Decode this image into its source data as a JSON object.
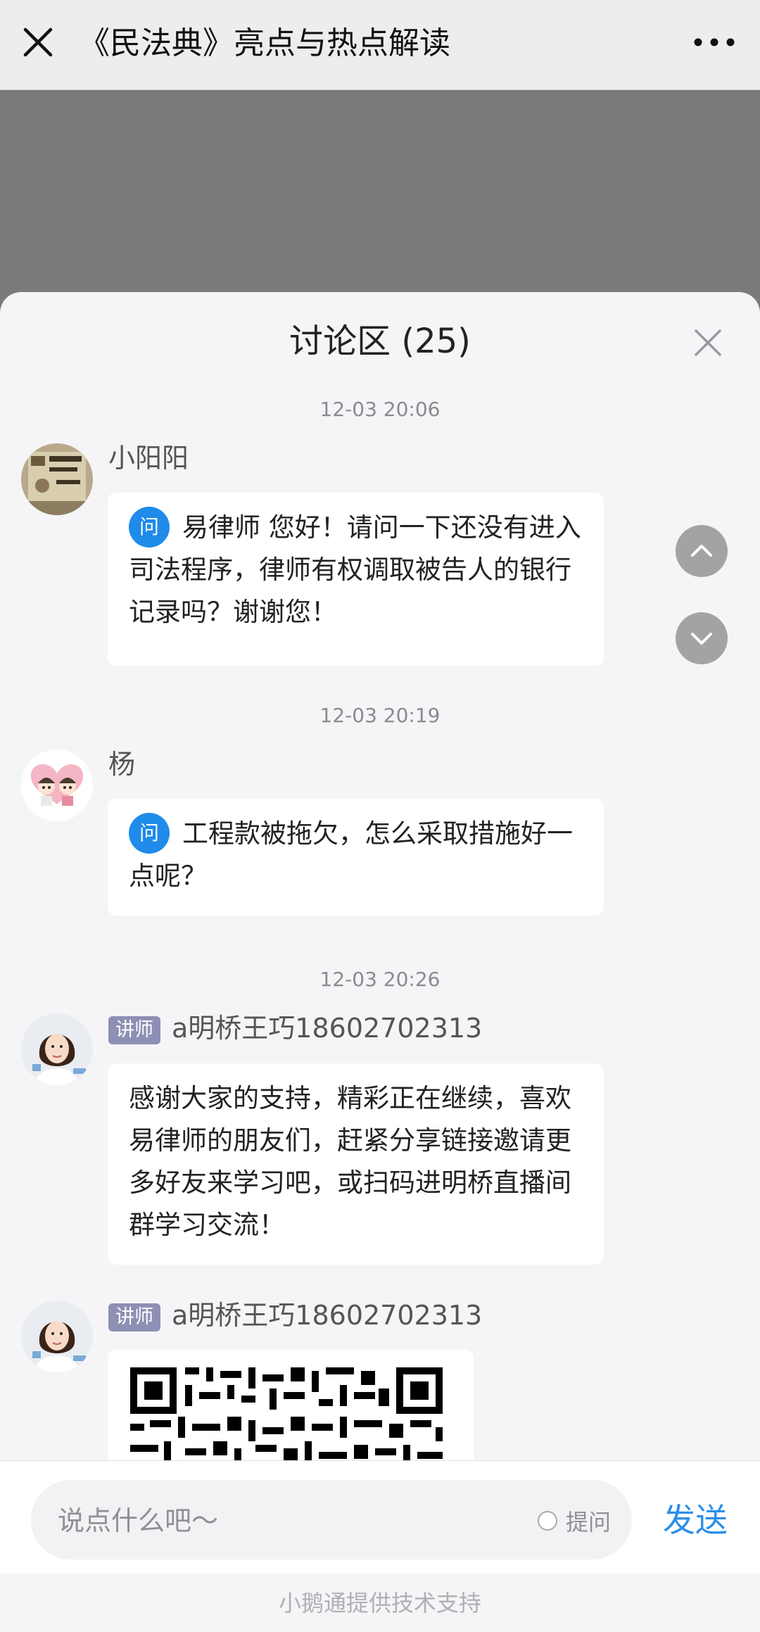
{
  "header": {
    "title": "《民法典》亮点与热点解读",
    "close_icon": "close-icon",
    "more_icon": "more-dots-icon"
  },
  "discussion": {
    "title": "讨论区 (25)",
    "close_icon": "close-icon"
  },
  "messages": [
    {
      "time": "12-03 20:06",
      "user": "小阳阳",
      "type": "question",
      "badge": "问",
      "text": "易律师 您好！请问一下还没有进入司法程序，律师有权调取被告人的银行记录吗？谢谢您！"
    },
    {
      "time": "12-03 20:19",
      "user": "杨",
      "type": "question",
      "badge": "问",
      "text": "工程款被拖欠，怎么采取措施好一点呢？"
    },
    {
      "time": "12-03 20:26",
      "user": "a明桥王巧18602702313",
      "role": "讲师",
      "type": "text",
      "text": "感谢大家的支持，精彩正在继续，喜欢易律师的朋友们，赶紧分享链接邀请更多好友来学习吧，或扫码进明桥直播间群学习交流！"
    },
    {
      "user": "a明桥王巧18602702313",
      "role": "讲师",
      "type": "image",
      "image": "qr-code"
    }
  ],
  "input": {
    "placeholder": "说点什么吧〜",
    "ask_label": "提问",
    "send_label": "发送"
  },
  "footer": {
    "text": "小鹅通提供技术支持"
  },
  "colors": {
    "accent": "#2c8fe8",
    "question_badge": "#1f8bea",
    "lecturer_badge": "#8d8fb4"
  }
}
